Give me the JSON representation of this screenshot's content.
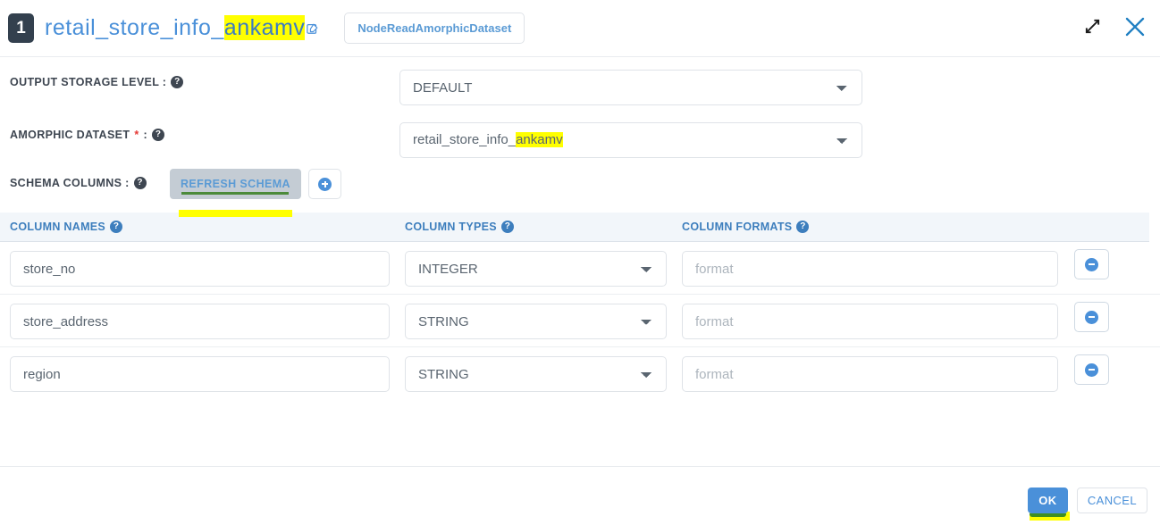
{
  "header": {
    "node_number": "1",
    "title_prefix": "retail_store_info_",
    "title_highlight": "ankamv",
    "edit_icon": "edit-pencil-icon",
    "node_type": "NodeReadAmorphicDataset",
    "expand_icon": "expand-arrows-icon",
    "close_icon": "close-x-icon"
  },
  "fields": {
    "output_storage_level": {
      "label": "OUTPUT STORAGE LEVEL :",
      "help_icon": "help-circle-icon",
      "value": "DEFAULT",
      "options": [
        "DEFAULT"
      ]
    },
    "amorphic_dataset": {
      "label": "AMORPHIC DATASET",
      "required_marker": "*",
      "label_suffix": ":",
      "help_icon": "help-circle-icon",
      "value_prefix": "retail_store_info_",
      "value_highlight": "ankamv",
      "value": "retail_store_info_ankamv",
      "options": [
        "retail_store_info_ankamv"
      ]
    },
    "schema_columns": {
      "label": "SCHEMA COLUMNS :",
      "help_icon": "help-circle-icon",
      "refresh_label": "REFRESH SCHEMA",
      "add_icon": "plus-circle-icon"
    }
  },
  "table": {
    "headers": [
      {
        "label": "COLUMN NAMES",
        "help_icon": "help-circle-icon"
      },
      {
        "label": "COLUMN TYPES",
        "help_icon": "help-circle-icon"
      },
      {
        "label": "COLUMN FORMATS",
        "help_icon": "help-circle-icon"
      }
    ],
    "format_placeholder": "format",
    "remove_icon": "minus-circle-icon",
    "type_options": [
      "INTEGER",
      "STRING"
    ],
    "rows": [
      {
        "name": "store_no",
        "type": "INTEGER",
        "format": ""
      },
      {
        "name": "store_address",
        "type": "STRING",
        "format": ""
      },
      {
        "name": "region",
        "type": "STRING",
        "format": ""
      }
    ]
  },
  "footer": {
    "ok_label": "OK",
    "cancel_label": "CANCEL"
  },
  "colors": {
    "accent_blue": "#4a90d9",
    "badge_dark": "#33404e",
    "header_band": "#f2f6fa",
    "highlight_yellow": "#ffff00",
    "required_red": "#e53935",
    "ok_green_edge": "#3f8f20"
  }
}
